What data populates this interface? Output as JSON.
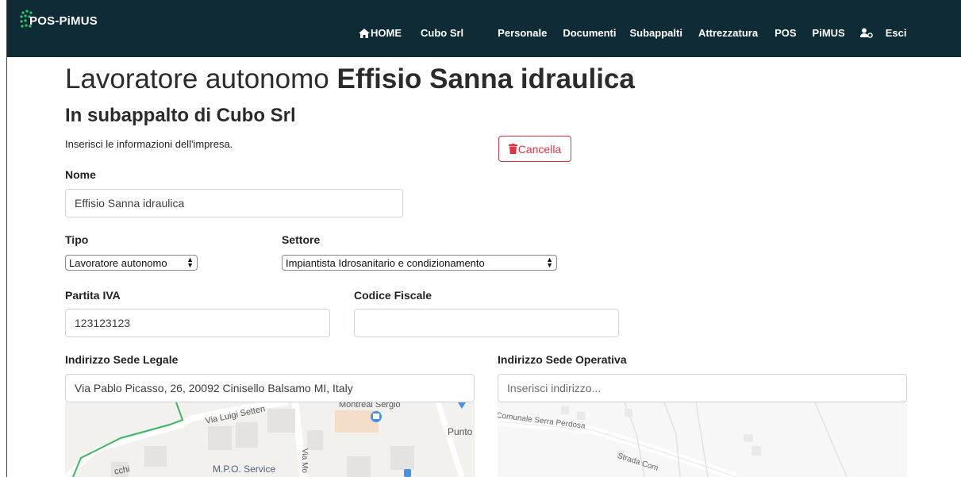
{
  "navbar": {
    "brand": "POS-PiMUS",
    "items": [
      "HOME",
      "Cubo Srl",
      "Personale",
      "Documenti",
      "Subappalti",
      "Attrezzatura",
      "POS",
      "PiMUS",
      "Esci"
    ],
    "bg_color": "#0f2c36",
    "logo_color": "#2ecc71"
  },
  "page": {
    "title_prefix": "Lavoratore autonomo",
    "title_name": "Effisio Sanna idraulica",
    "subtitle": "In subappalto di Cubo Srl",
    "intro": "Inserisci le informazioni dell'impresa.",
    "delete_button": "Cancella"
  },
  "form": {
    "nome_label": "Nome",
    "nome_value": "Effisio Sanna idraulica",
    "tipo_label": "Tipo",
    "tipo_value": "Lavoratore autonomo",
    "settore_label": "Settore",
    "settore_value": "Impiantista Idrosanitario e condizionamento",
    "piva_label": "Partita IVA",
    "piva_value": "123123123",
    "cf_label": "Codice Fiscale",
    "cf_value": "",
    "sede_legale_label": "Indirizzo Sede Legale",
    "sede_legale_value": "Via Pablo Picasso, 26, 20092 Cinisello Balsamo MI, Italy",
    "sede_operativa_label": "Indirizzo Sede Operativa",
    "sede_operativa_placeholder": "Inserisci indirizzo..."
  },
  "map_left": {
    "labels": [
      "Via Luigi Setten",
      "Montreal Sergio",
      "Punto",
      "M.P.O. Service",
      "Via Mo",
      "cchi"
    ]
  },
  "map_right": {
    "labels": [
      "Comunale Serra Perdosa",
      "Strada Com"
    ]
  },
  "colors": {
    "danger": "#dc3545",
    "accent_green": "#2ecc71"
  }
}
